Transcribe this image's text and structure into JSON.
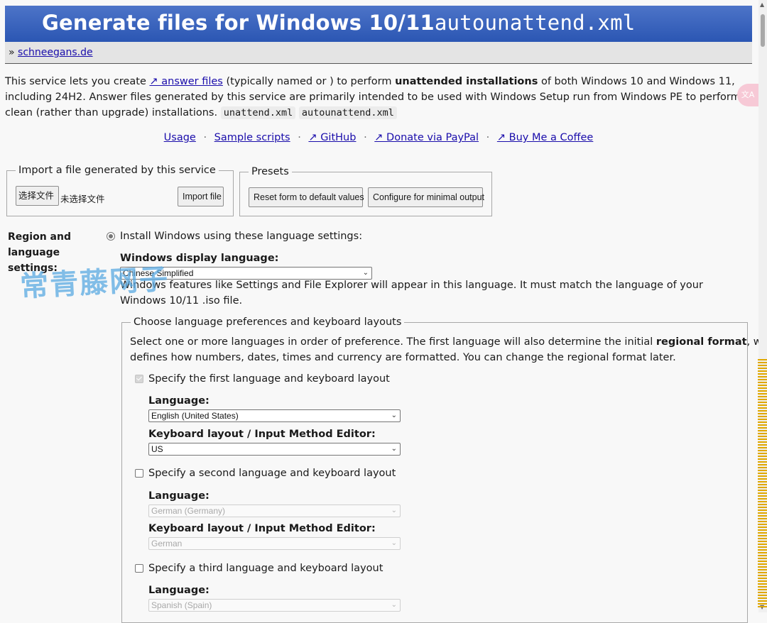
{
  "header": {
    "title_prefix": "Generate files for Windows 10/11",
    "title_mono": "autounattend.xml"
  },
  "breadcrumb": {
    "separator": "»",
    "link": "schneegans.de"
  },
  "intro": {
    "p1": "This service lets you create ",
    "answer_files": "↗ answer files",
    "p2": " (typically named or ) to perform ",
    "bold": "unattended installations",
    "p3": " of both Windows 10 and Windows 11, including 24H2. Answer files generated by this service are primarily intended to be used with Windows Setup run from Windows PE to perform clean (rather than upgrade) installations. ",
    "code1": "unattend.xml",
    "code2": "autounattend.xml"
  },
  "links": {
    "usage": "Usage",
    "sample_scripts": "Sample scripts",
    "github": "↗ GitHub",
    "paypal": "↗ Donate via PayPal",
    "coffee": "↗ Buy Me a Coffee",
    "dot": "·"
  },
  "import_box": {
    "legend": "Import a file generated by this service",
    "choose_button": "选择文件",
    "no_file": "未选择文件",
    "import_button": "Import file"
  },
  "presets_box": {
    "legend": "Presets",
    "reset_button": "Reset form to default values",
    "minimal_button": "Configure for minimal output"
  },
  "region": {
    "label": "Region and language settings:",
    "radio_label": "Install Windows using these language settings:",
    "display_language_label": "Windows display language:",
    "display_language_value": "Chinese Simplified",
    "display_help_1": "Windows features like Settings and File Explorer will appear in this language. It must match the language of your",
    "display_help_2": "Windows 10/11 .iso file."
  },
  "prefs": {
    "legend": "Choose language preferences and keyboard layouts",
    "desc_1a": "Select one or more languages in order of preference. The first language will also determine the initial ",
    "desc_bold": "regional format",
    "desc_1b": ", which",
    "desc_2": "defines how numbers, dates, times and currency are formatted. You can change the regional format later.",
    "first": {
      "label": "Specify the first language and keyboard layout",
      "language_label": "Language:",
      "language_value": "English (United States)",
      "keyboard_label": "Keyboard layout / Input Method Editor:",
      "keyboard_value": "US"
    },
    "second": {
      "label": "Specify a second language and keyboard layout",
      "language_label": "Language:",
      "language_value": "German (Germany)",
      "keyboard_label": "Keyboard layout / Input Method Editor:",
      "keyboard_value": "German"
    },
    "third": {
      "label": "Specify a third language and keyboard layout",
      "language_label": "Language:",
      "language_value": "Spanish (Spain)"
    }
  },
  "watermark": "常青藤网子",
  "translate_icon": "文A"
}
